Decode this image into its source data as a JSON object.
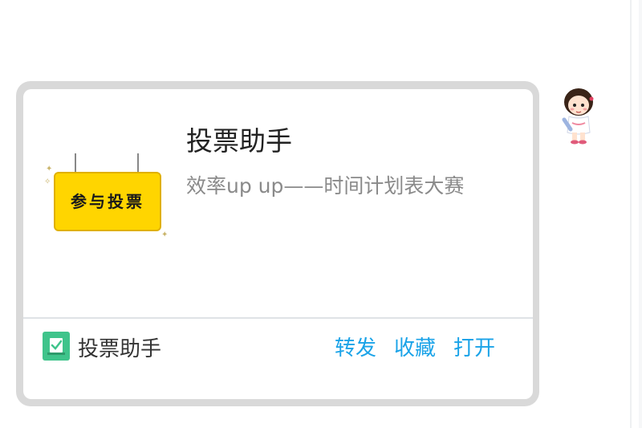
{
  "card": {
    "thumbnail_text": "参与投票",
    "title": "投票助手",
    "subtitle": "效率up up——时间计划表大赛"
  },
  "footer": {
    "app_name": "投票助手",
    "actions": [
      "转发",
      "收藏",
      "打开"
    ]
  },
  "colors": {
    "accent": "#1aa3e8",
    "app_logo": "#3fc48b",
    "sign": "#ffd500",
    "frame": "#d9d9d9"
  },
  "icons": {
    "app_logo": "vote-assistant-logo-icon",
    "avatar": "cartoon-girl-avatar"
  }
}
